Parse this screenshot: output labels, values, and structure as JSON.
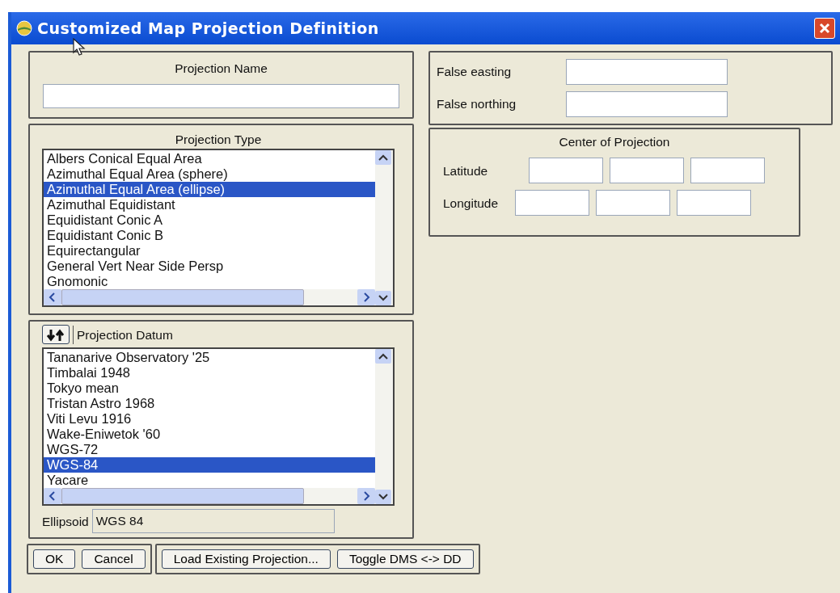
{
  "window": {
    "title": "Customized Map Projection Definition"
  },
  "projection_name": {
    "label": "Projection Name"
  },
  "projection_type": {
    "label": "Projection Type",
    "items": [
      {
        "label": "Albers Conical Equal Area",
        "selected": false
      },
      {
        "label": "Azimuthal Equal Area (sphere)",
        "selected": false
      },
      {
        "label": "Azimuthal Equal Area (ellipse)",
        "selected": true
      },
      {
        "label": "Azimuthal Equidistant",
        "selected": false
      },
      {
        "label": "Equidistant Conic A",
        "selected": false
      },
      {
        "label": "Equidistant Conic B",
        "selected": false
      },
      {
        "label": "Equirectangular",
        "selected": false
      },
      {
        "label": "General Vert Near Side Persp",
        "selected": false
      },
      {
        "label": "Gnomonic",
        "selected": false
      }
    ]
  },
  "projection_datum": {
    "label": "Projection Datum",
    "items": [
      {
        "label": "Tananarive Observatory '25",
        "selected": false
      },
      {
        "label": "Timbalai 1948",
        "selected": false
      },
      {
        "label": "Tokyo mean",
        "selected": false
      },
      {
        "label": "Tristan Astro 1968",
        "selected": false
      },
      {
        "label": "Viti Levu 1916",
        "selected": false
      },
      {
        "label": "Wake-Eniwetok '60",
        "selected": false
      },
      {
        "label": "WGS-72",
        "selected": false
      },
      {
        "label": "WGS-84",
        "selected": true
      },
      {
        "label": "Yacare",
        "selected": false
      }
    ],
    "ellipsoid": {
      "label": "Ellipsoid",
      "value": "WGS 84"
    }
  },
  "false_origin": {
    "fields": [
      {
        "label": "False easting"
      },
      {
        "label": "False northing"
      }
    ]
  },
  "center": {
    "title": "Center of Projection",
    "rows": [
      {
        "label": "Latitude"
      },
      {
        "label": "Longitude"
      }
    ]
  },
  "button_groups": [
    [
      "OK",
      "Cancel"
    ],
    [
      "Load Existing Projection...",
      "Toggle DMS <-> DD"
    ]
  ]
}
